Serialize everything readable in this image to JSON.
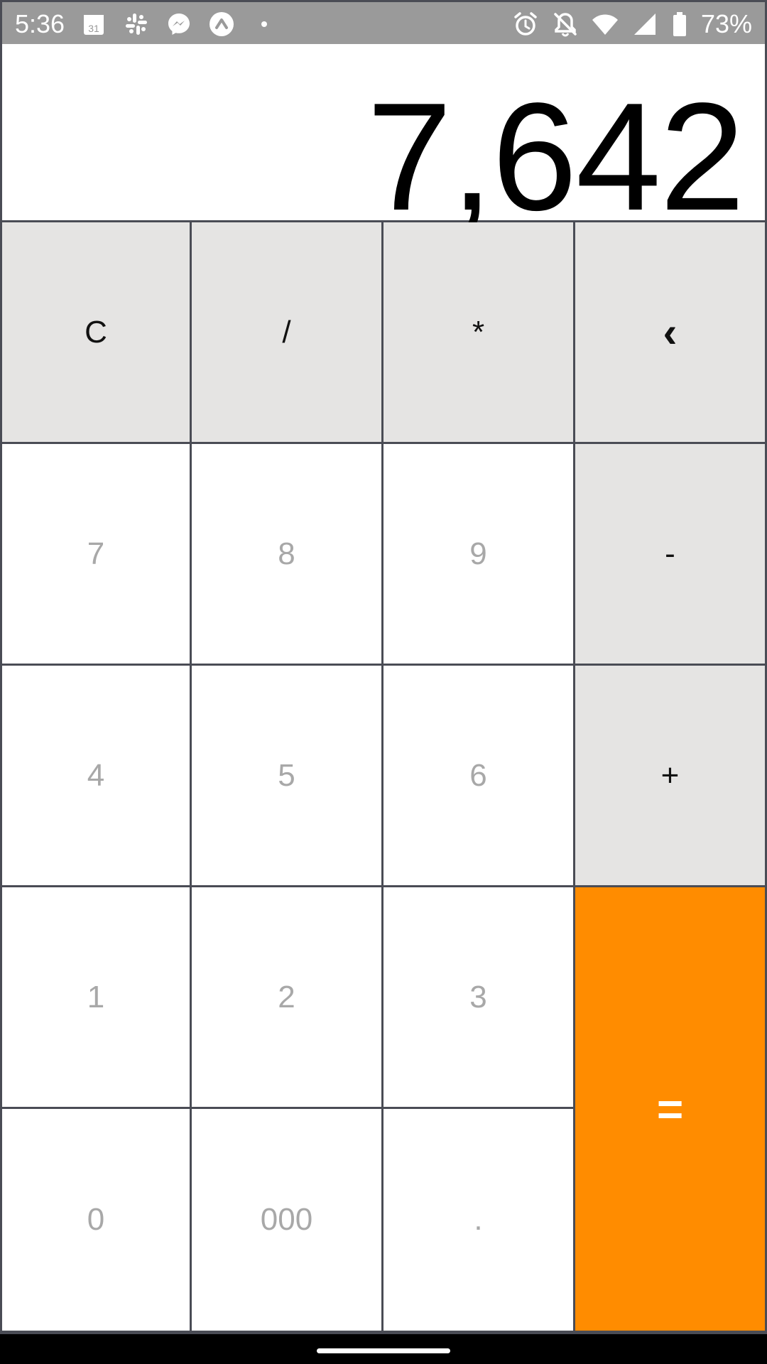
{
  "status_bar": {
    "time": "5:36",
    "calendar_day": "31",
    "battery_percent": "73%",
    "left_icons": [
      "calendar-icon",
      "slack-icon",
      "messenger-icon",
      "app-circle-icon",
      "notification-dot-icon"
    ],
    "right_icons": [
      "alarm-icon",
      "bell-off-icon",
      "wifi-icon",
      "signal-icon",
      "battery-icon"
    ]
  },
  "display": {
    "value": "7,642"
  },
  "keys": {
    "clear": "C",
    "divide": "/",
    "multiply": "*",
    "backspace": "‹",
    "seven": "7",
    "eight": "8",
    "nine": "9",
    "minus": "-",
    "four": "4",
    "five": "5",
    "six": "6",
    "plus": "+",
    "one": "1",
    "two": "2",
    "three": "3",
    "equals": "=",
    "zero": "0",
    "triple_zero": "000",
    "decimal": "."
  },
  "colors": {
    "operator_key": "#e5e4e3",
    "equals_key": "#ff8c00",
    "digit_text": "#a8a8a8",
    "grid_lines": "#4a4c55"
  }
}
